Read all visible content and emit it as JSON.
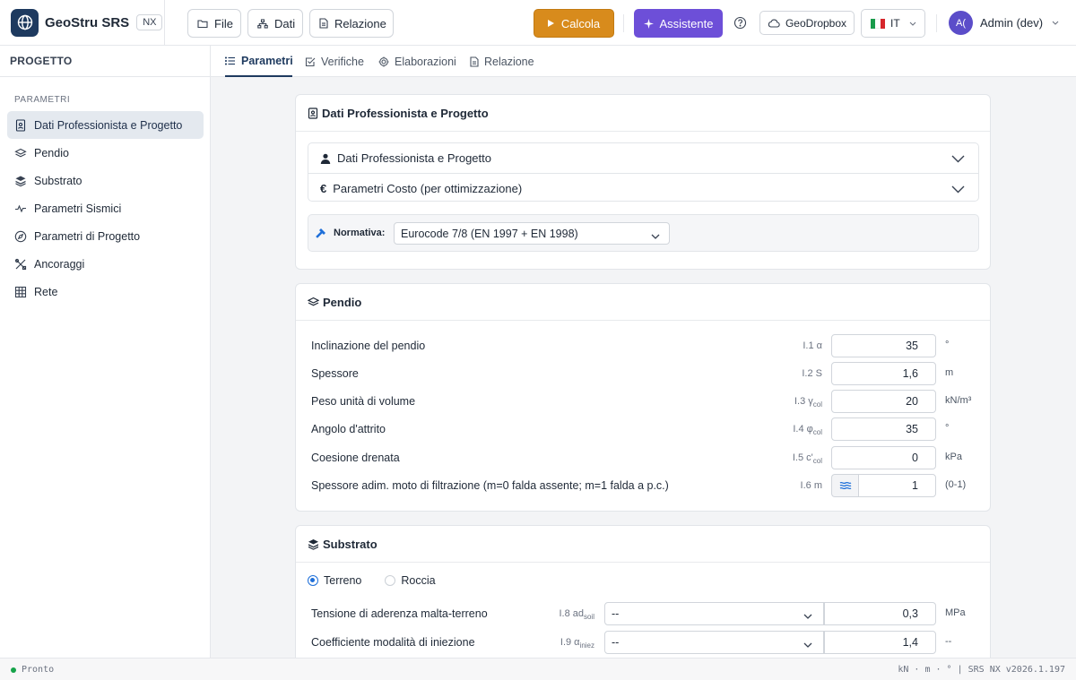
{
  "header": {
    "brand": "GeoStru SRS",
    "badge": "NX",
    "menu": {
      "file": "File",
      "dati": "Dati",
      "relazione": "Relazione"
    },
    "calcola": "Calcola",
    "assistente": "Assistente",
    "geodropbox": "GeoDropbox",
    "language": "IT",
    "user": {
      "initials": "A(",
      "name": "Admin (dev)"
    }
  },
  "sidebar": {
    "title": "PROGETTO",
    "section": "PARAMETRI",
    "items": [
      {
        "label": "Dati Professionista e Progetto",
        "icon": "id-badge-icon",
        "active": true
      },
      {
        "label": "Pendio",
        "icon": "layers-outline-icon"
      },
      {
        "label": "Substrato",
        "icon": "layers-filled-icon"
      },
      {
        "label": "Parametri Sismici",
        "icon": "pulse-icon"
      },
      {
        "label": "Parametri di Progetto",
        "icon": "compass-icon"
      },
      {
        "label": "Ancoraggi",
        "icon": "tools-icon"
      },
      {
        "label": "Rete",
        "icon": "grid-icon"
      }
    ]
  },
  "tabs": [
    {
      "label": "Parametri",
      "icon": "list-icon",
      "active": true
    },
    {
      "label": "Verifiche",
      "icon": "check-square-icon"
    },
    {
      "label": "Elaborazioni",
      "icon": "cpu-icon"
    },
    {
      "label": "Relazione",
      "icon": "document-icon"
    }
  ],
  "dati_card": {
    "title": "Dati Professionista e Progetto",
    "accordions": [
      {
        "label": "Dati Professionista e Progetto",
        "icon": "user-icon"
      },
      {
        "label": "Parametri Costo (per ottimizzazione)",
        "icon": "euro-icon"
      }
    ],
    "normativa": {
      "label": "Normativa:",
      "value": "Eurocode 7/8 (EN 1997 + EN 1998)"
    }
  },
  "pendio_card": {
    "title": "Pendio",
    "rows": [
      {
        "label": "Inclinazione del pendio",
        "code": "I.1 α",
        "sub": "",
        "value": "35",
        "unit": "°"
      },
      {
        "label": "Spessore",
        "code": "I.2 S",
        "sub": "",
        "value": "1,6",
        "unit": "m"
      },
      {
        "label": "Peso unità di volume",
        "code": "I.3 γ",
        "sub": "col",
        "value": "20",
        "unit": "kN/m³"
      },
      {
        "label": "Angolo d'attrito",
        "code": "I.4 φ",
        "sub": "col",
        "value": "35",
        "unit": "°"
      },
      {
        "label": "Coesione drenata",
        "code": "I.5 c'",
        "sub": "col",
        "value": "0",
        "unit": "kPa"
      },
      {
        "label": "Spessore adim. moto di filtrazione (m=0 falda assente; m=1 falda a p.c.)",
        "code": "I.6 m",
        "sub": "",
        "value": "1",
        "unit": "(0-1)"
      }
    ]
  },
  "substrato_card": {
    "title": "Substrato",
    "radio": {
      "terreno": "Terreno",
      "roccia": "Roccia"
    },
    "rows": [
      {
        "label": "Tensione di aderenza malta-terreno",
        "code": "I.8 ad",
        "sub": "soil",
        "select": "--",
        "value": "0,3",
        "unit": "MPa"
      },
      {
        "label": "Coefficiente modalità di iniezione",
        "code": "I.9 α",
        "sub": "iniez",
        "select": "--",
        "value": "1,4",
        "unit": "--"
      }
    ]
  },
  "status": {
    "left": "Pronto",
    "right": "kN · m · ° | SRS NX v2026.1.197"
  }
}
